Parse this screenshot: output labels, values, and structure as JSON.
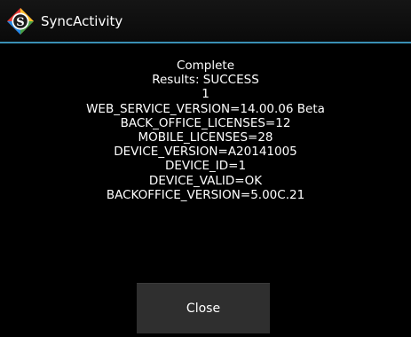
{
  "app": {
    "title": "SyncActivity",
    "logo_icon": "syncactivity-logo-icon",
    "accent_color": "#3a8fb5"
  },
  "dialog": {
    "lines": [
      "Complete",
      "Results: SUCCESS",
      "1",
      "WEB_SERVICE_VERSION=14.00.06 Beta",
      "BACK_OFFICE_LICENSES=12",
      "MOBILE_LICENSES=28",
      "DEVICE_VERSION=A20141005",
      "DEVICE_ID=1",
      "DEVICE_VALID=OK",
      "BACKOFFICE_VERSION=5.00C.21"
    ],
    "close_label": "Close"
  }
}
